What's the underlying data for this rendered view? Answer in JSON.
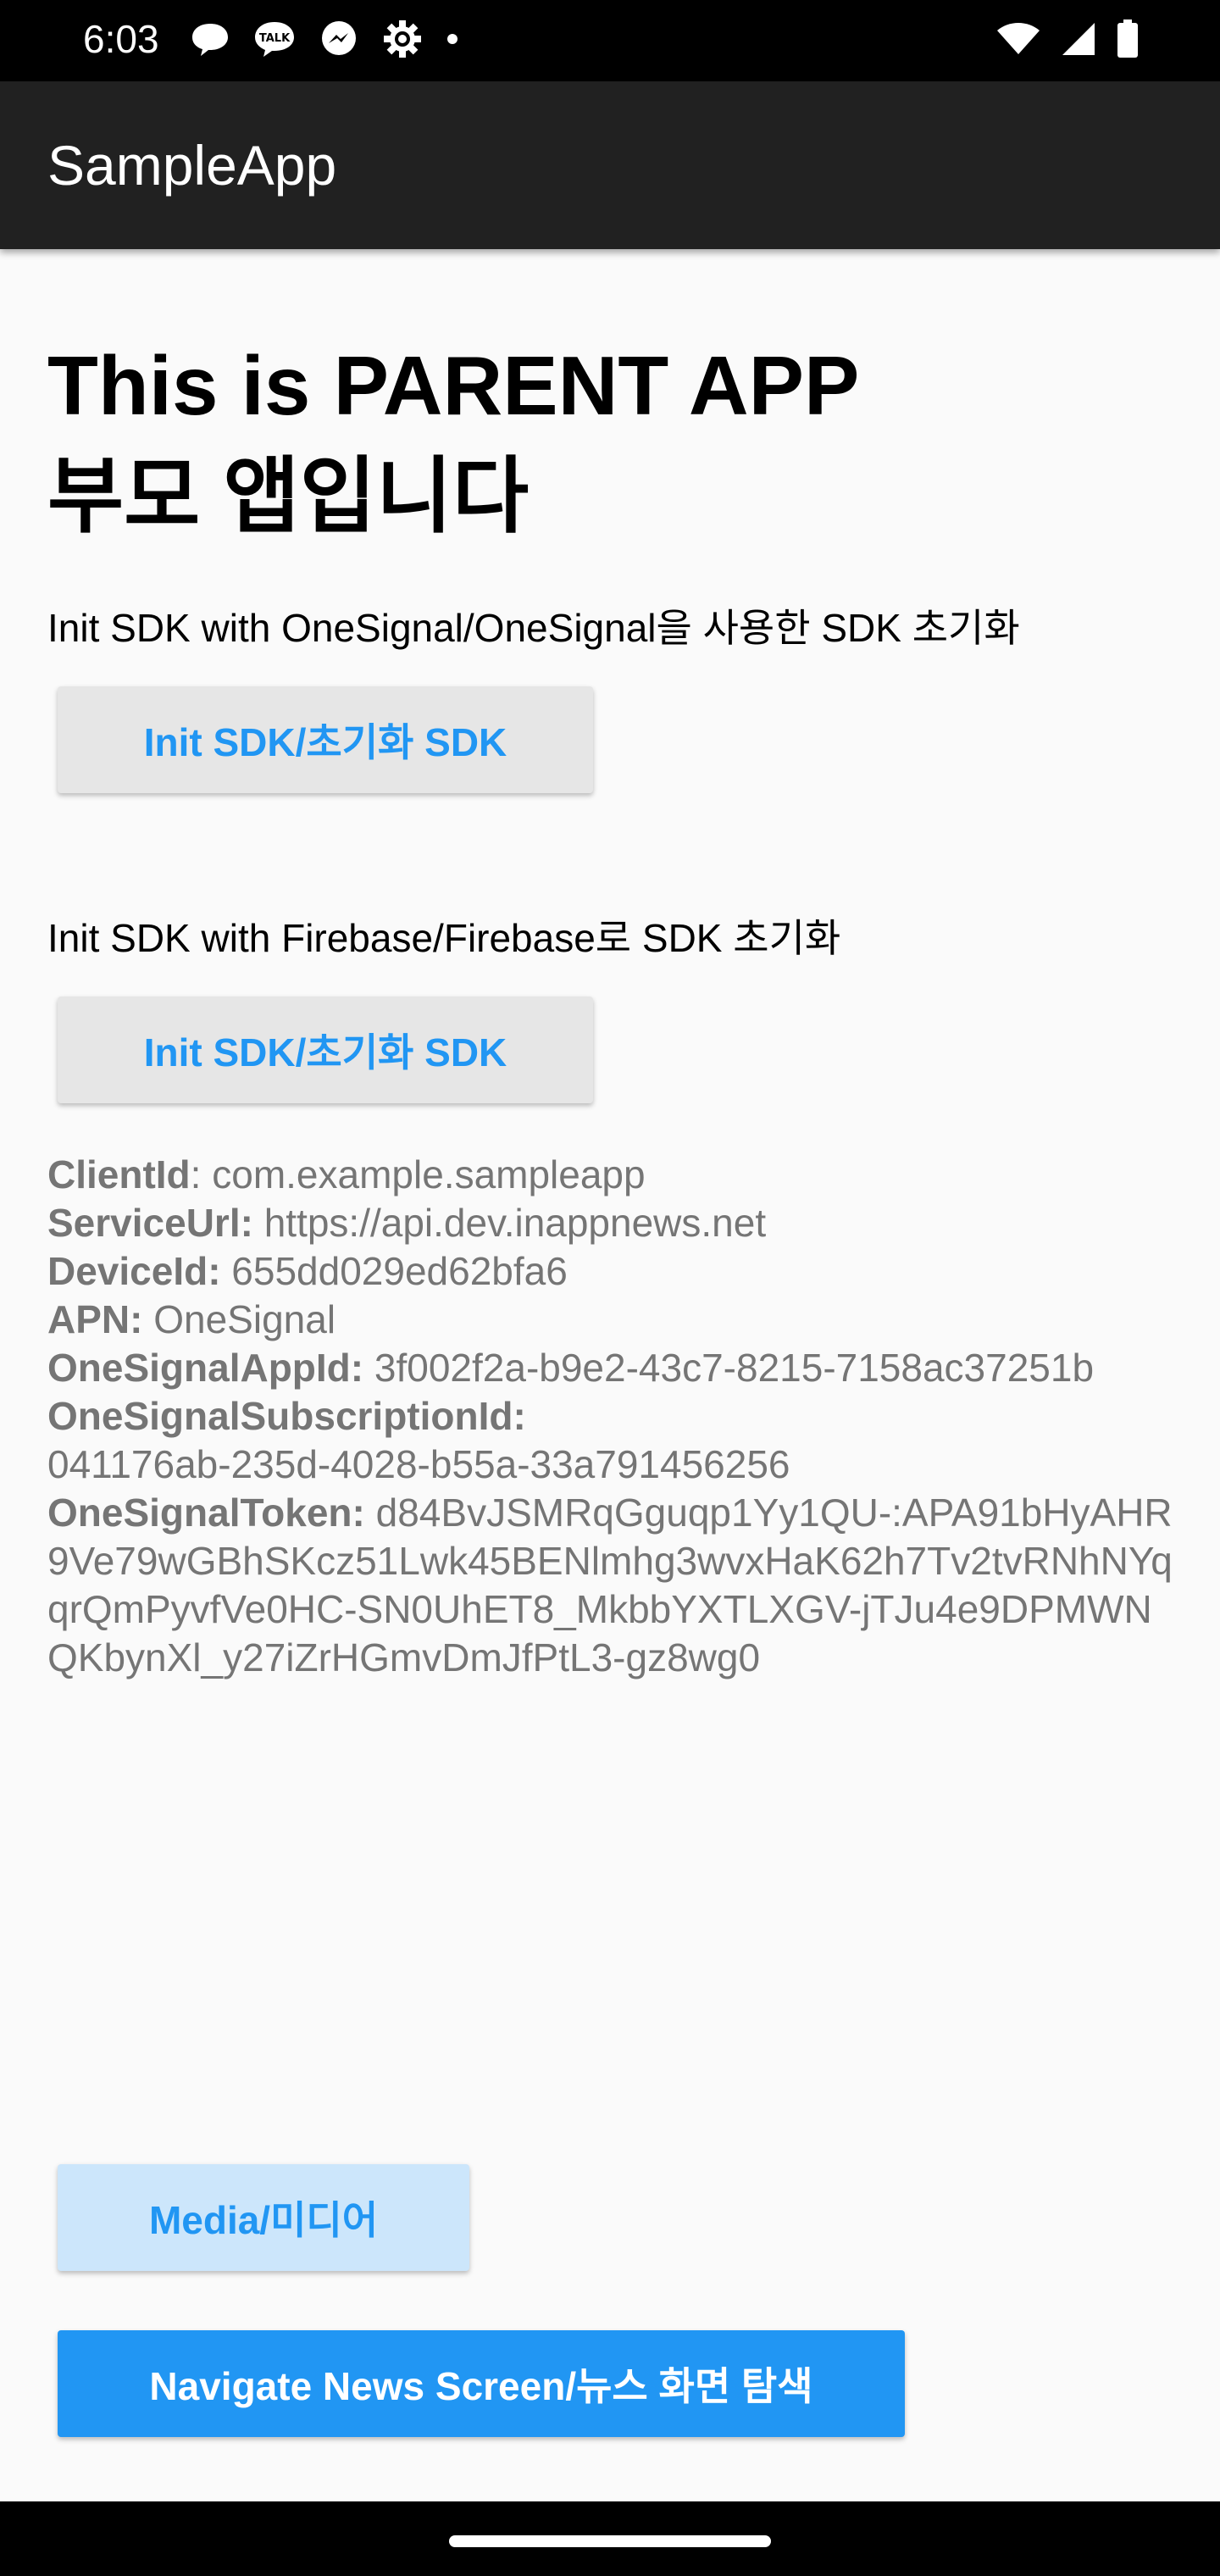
{
  "status_bar": {
    "time": "6:03",
    "left_icons": [
      "chat-bubble-icon",
      "kakaotalk-icon",
      "messenger-icon",
      "settings-gear-icon",
      "dot-icon"
    ],
    "right_icons": [
      "wifi-icon",
      "cellular-signal-icon",
      "battery-icon"
    ],
    "talk_icon_text": "TALK"
  },
  "app_bar": {
    "title": "SampleApp"
  },
  "heading": {
    "line1": "This is PARENT APP",
    "line2": "부모 앱입니다"
  },
  "onesignal_section": {
    "label": "Init SDK with OneSignal/OneSignal을 사용한 SDK 초기화",
    "button_label": "Init SDK/초기화 SDK"
  },
  "firebase_section": {
    "label": "Init SDK with Firebase/Firebase로 SDK 초기화",
    "button_label": "Init SDK/초기화 SDK"
  },
  "info": {
    "client_id_key": "ClientId",
    "client_id_value": ": com.example.sampleapp",
    "service_url_key": "ServiceUrl:",
    "service_url_value": " https://api.dev.inappnews.net",
    "device_id_key": "DeviceId:",
    "device_id_value": " 655dd029ed62bfa6",
    "apn_key": "APN:",
    "apn_value": " OneSignal",
    "onesignal_app_id_key": "OneSignalAppId:",
    "onesignal_app_id_value": " 3f002f2a-b9e2-43c7-8215-7158ac37251b",
    "onesignal_subscription_id_key": "OneSignalSubscriptionId:",
    "onesignal_subscription_id_value": "041176ab-235d-4028-b55a-33a791456256",
    "onesignal_token_key": "OneSignalToken:",
    "onesignal_token_value": " d84BvJSMRqGguqp1Yy1QU-:APA91bHyAHR9Ve79wGBhSKcz51Lwk45BENlmhg3wvxHaK62h7Tv2tvRNhNYqqrQmPyvfVe0HC-SN0UhET8_MkbbYXTLXGV-jTJu4e9DPMWNQKbynXl_y27iZrHGmvDmJfPtL3-gz8wg0"
  },
  "buttons": {
    "media_label": "Media/미디어",
    "navigate_label": "Navigate News Screen/뉴스 화면 탐색"
  },
  "colors": {
    "accent": "#2196f3",
    "app_bar": "#212121",
    "background": "#fafafa",
    "info_text": "#757575"
  }
}
